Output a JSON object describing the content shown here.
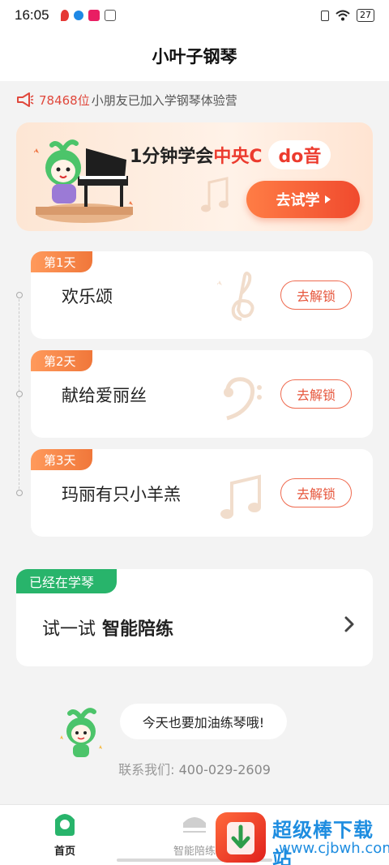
{
  "status_bar": {
    "time": "16:05",
    "battery": "27",
    "notification_colors": [
      "#e53935",
      "#1e88e5",
      "#e91e63",
      "#555555"
    ]
  },
  "header": {
    "title": "小叶子钢琴"
  },
  "joined": {
    "count": "78468位",
    "text": "小朋友已加入学钢琴体验营"
  },
  "promo": {
    "title_prefix": "1分钟学会",
    "title_highlight": "中央C",
    "title_pill": "do音",
    "button_label": "去试学"
  },
  "lessons": [
    {
      "day": "第1天",
      "name": "欢乐颂",
      "button": "去解锁"
    },
    {
      "day": "第2天",
      "name": "献给爱丽丝",
      "button": "去解锁"
    },
    {
      "day": "第3天",
      "name": "玛丽有只小羊羔",
      "button": "去解锁"
    }
  ],
  "practice": {
    "tag": "已经在学琴",
    "label_prefix": "试一试",
    "label_bold": "智能陪练"
  },
  "encourage": {
    "bubble": "今天也要加油练琴哦!"
  },
  "contact": {
    "label": "联系我们:",
    "phone": "400-029-2609"
  },
  "tabs": [
    {
      "label": "首页",
      "icon": "home-icon",
      "active": true
    },
    {
      "label": "智能陪练",
      "icon": "practice-icon",
      "active": false
    }
  ],
  "watermark": {
    "text": "超级棒下载站",
    "url": "www.cjbwh.com"
  },
  "colors": {
    "accent_orange": "#f0773a",
    "accent_red": "#ec3b2e",
    "green": "#28b46b"
  }
}
